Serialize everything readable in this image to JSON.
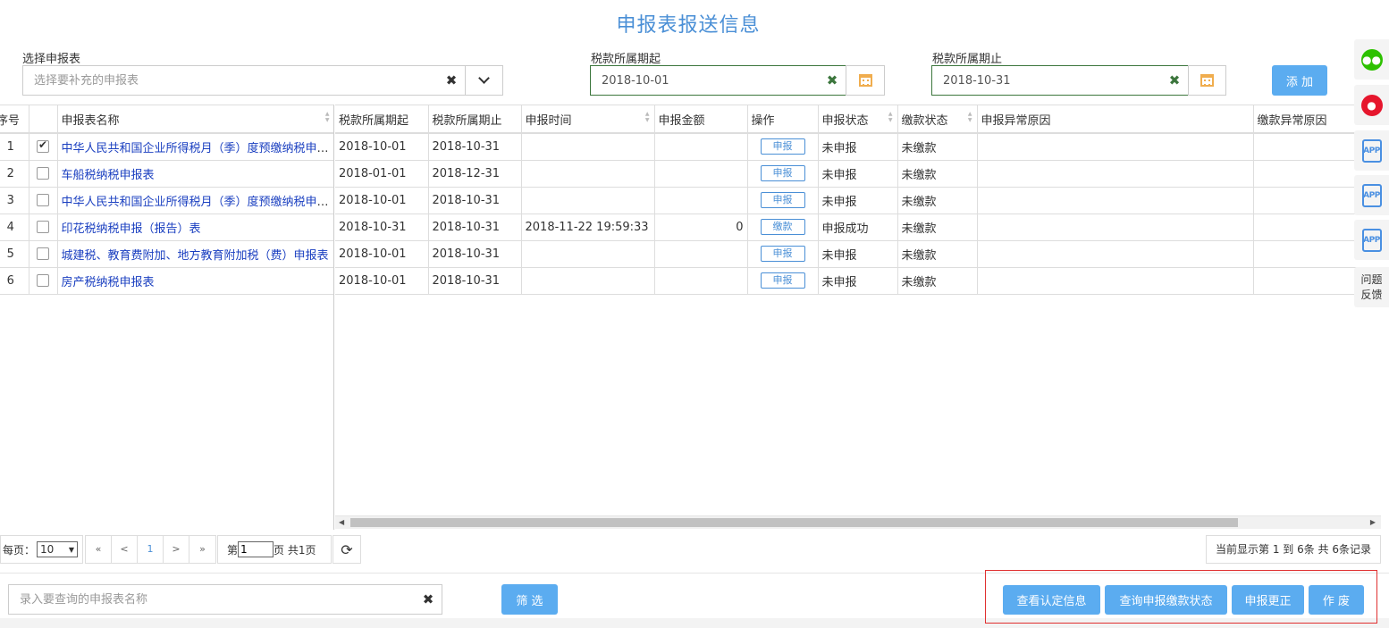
{
  "page": {
    "title": "申报表报送信息"
  },
  "form": {
    "select_label": "选择申报表",
    "select_placeholder": "选择要补充的申报表",
    "start_label": "税款所属期起",
    "start_value": "2018-10-01",
    "end_label": "税款所属期止",
    "end_value": "2018-10-31",
    "add_label": "添 加"
  },
  "left_table": {
    "headers": {
      "seq": "序号",
      "name": "申报表名称"
    },
    "rows": [
      {
        "seq": "1",
        "checked": true,
        "name": "中华人民共和国企业所得税月（季）度预缴纳税申报表"
      },
      {
        "seq": "2",
        "checked": false,
        "name": "车船税纳税申报表"
      },
      {
        "seq": "3",
        "checked": false,
        "name": "中华人民共和国企业所得税月（季）度预缴纳税申报表"
      },
      {
        "seq": "4",
        "checked": false,
        "name": "印花税纳税申报（报告）表"
      },
      {
        "seq": "5",
        "checked": false,
        "name": "城建税、教育费附加、地方教育附加税（费）申报表"
      },
      {
        "seq": "6",
        "checked": false,
        "name": "房产税纳税申报表"
      }
    ]
  },
  "right_table": {
    "headers": {
      "start": "税款所属期起",
      "end": "税款所属期止",
      "time": "申报时间",
      "amount": "申报金额",
      "op": "操作",
      "status": "申报状态",
      "pay_status": "缴款状态",
      "decl_err": "申报异常原因",
      "pay_err": "缴款异常原因"
    },
    "rows": [
      {
        "start": "2018-10-01",
        "end": "2018-10-31",
        "time": "",
        "amount": "",
        "op": "申报",
        "status": "未申报",
        "pay_status": "未缴款",
        "decl_err": "",
        "pay_err": ""
      },
      {
        "start": "2018-01-01",
        "end": "2018-12-31",
        "time": "",
        "amount": "",
        "op": "申报",
        "status": "未申报",
        "pay_status": "未缴款",
        "decl_err": "",
        "pay_err": ""
      },
      {
        "start": "2018-10-01",
        "end": "2018-10-31",
        "time": "",
        "amount": "",
        "op": "申报",
        "status": "未申报",
        "pay_status": "未缴款",
        "decl_err": "",
        "pay_err": ""
      },
      {
        "start": "2018-10-31",
        "end": "2018-10-31",
        "time": "2018-11-22 19:59:33",
        "amount": "0",
        "op": "缴款",
        "status": "申报成功",
        "pay_status": "未缴款",
        "decl_err": "",
        "pay_err": ""
      },
      {
        "start": "2018-10-01",
        "end": "2018-10-31",
        "time": "",
        "amount": "",
        "op": "申报",
        "status": "未申报",
        "pay_status": "未缴款",
        "decl_err": "",
        "pay_err": ""
      },
      {
        "start": "2018-10-01",
        "end": "2018-10-31",
        "time": "",
        "amount": "",
        "op": "申报",
        "status": "未申报",
        "pay_status": "未缴款",
        "decl_err": "",
        "pay_err": ""
      }
    ]
  },
  "pager": {
    "per_page_label": "每页：",
    "per_page_value": "10",
    "first": "«",
    "prev": "<",
    "current": "1",
    "next": ">",
    "last": "»",
    "page_prefix": "第",
    "page_input": "1",
    "page_suffix": "页 共1页",
    "summary": "当前显示第 1 到 6条  共 6条记录"
  },
  "footer": {
    "search_placeholder": "录入要查询的申报表名称",
    "filter_label": "筛 选",
    "btn_view_cert": "查看认定信息",
    "btn_query_status": "查询申报缴款状态",
    "btn_correct": "申报更正",
    "btn_void": "作 废"
  },
  "side": {
    "app_label": "APP",
    "feedback_line1": "问题",
    "feedback_line2": "反馈"
  },
  "colors": {
    "accent": "#5bacf0",
    "title": "#4a8fd6",
    "link": "#1a3fc0",
    "valid_border": "#3c763d",
    "highlight": "#e03030"
  }
}
